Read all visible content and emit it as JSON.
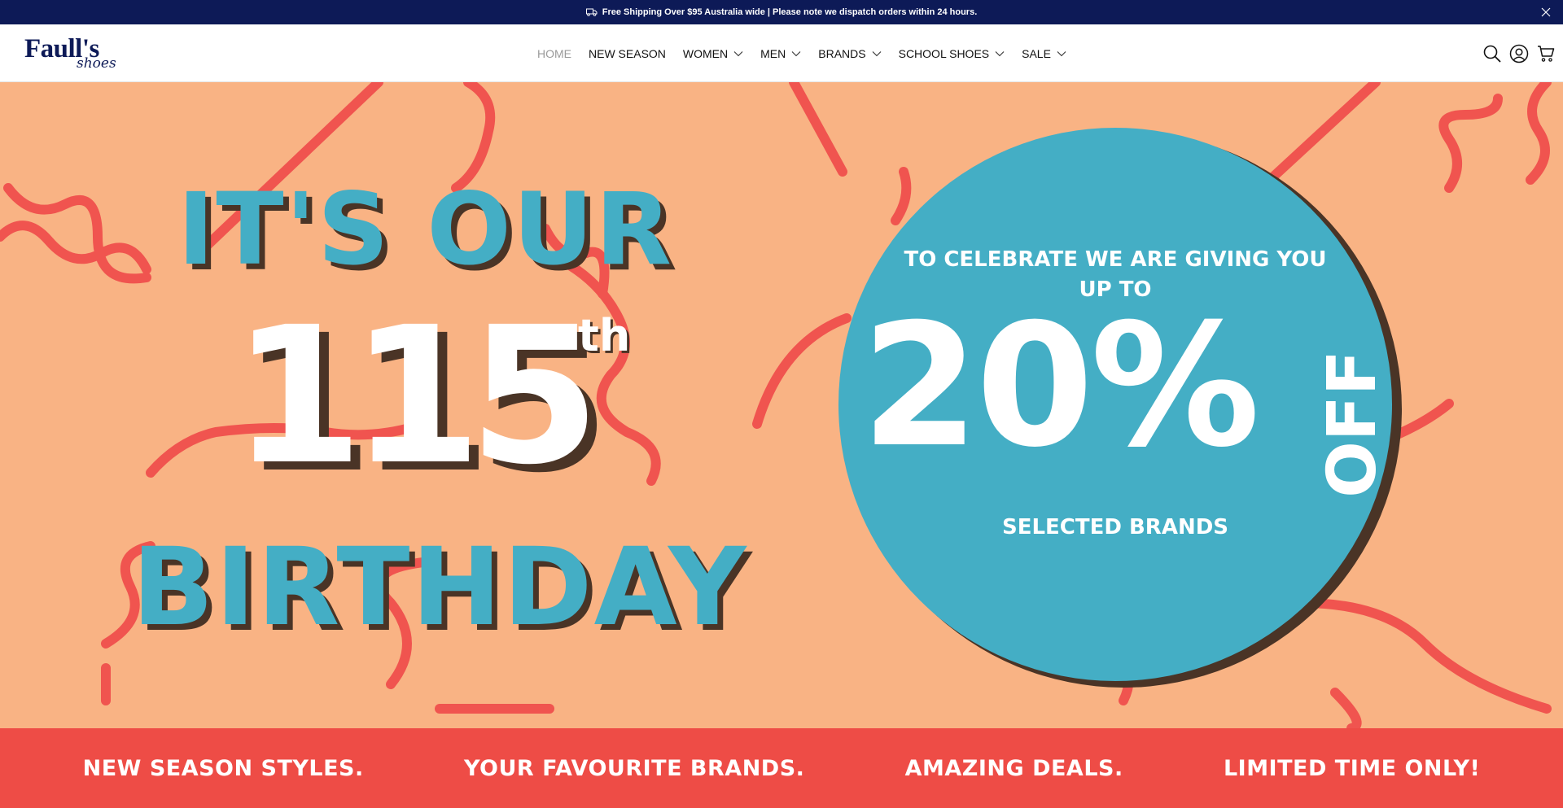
{
  "announcement": {
    "text": "Free Shipping Over $95 Australia wide | Please note we dispatch orders within 24 hours.",
    "icon": "truck-icon",
    "close_icon": "close-icon"
  },
  "header": {
    "logo_main": "Faull's",
    "logo_sub": "shoes",
    "nav": [
      {
        "label": "HOME",
        "active": true,
        "dropdown": false
      },
      {
        "label": "NEW SEASON",
        "active": false,
        "dropdown": false
      },
      {
        "label": "WOMEN",
        "active": false,
        "dropdown": true
      },
      {
        "label": "MEN",
        "active": false,
        "dropdown": true
      },
      {
        "label": "BRANDS",
        "active": false,
        "dropdown": true
      },
      {
        "label": "SCHOOL SHOES",
        "active": false,
        "dropdown": true
      },
      {
        "label": "SALE",
        "active": false,
        "dropdown": true
      }
    ],
    "icons": [
      "search-icon",
      "account-icon",
      "cart-icon"
    ]
  },
  "hero": {
    "line1": "IT'S OUR",
    "number": "115",
    "suffix": "th",
    "line3": "BIRTHDAY",
    "circle_text": "TO CELEBRATE WE ARE GIVING YOU UP TO",
    "discount": "20%",
    "off": "OFF",
    "brands": "SELECTED BRANDS",
    "colors": {
      "background": "#f9b384",
      "accent_blue": "#44aec5",
      "squiggle": "#f0544f",
      "shadow": "#4a3426"
    }
  },
  "bottom_strip": {
    "items": [
      "NEW SEASON STYLES.",
      "YOUR FAVOURITE BRANDS.",
      "AMAZING DEALS.",
      "LIMITED TIME ONLY!"
    ],
    "color": "#ee4c46"
  },
  "colors": {
    "announcement_bg": "#0d1a57",
    "brand_navy": "#0d1a57"
  }
}
